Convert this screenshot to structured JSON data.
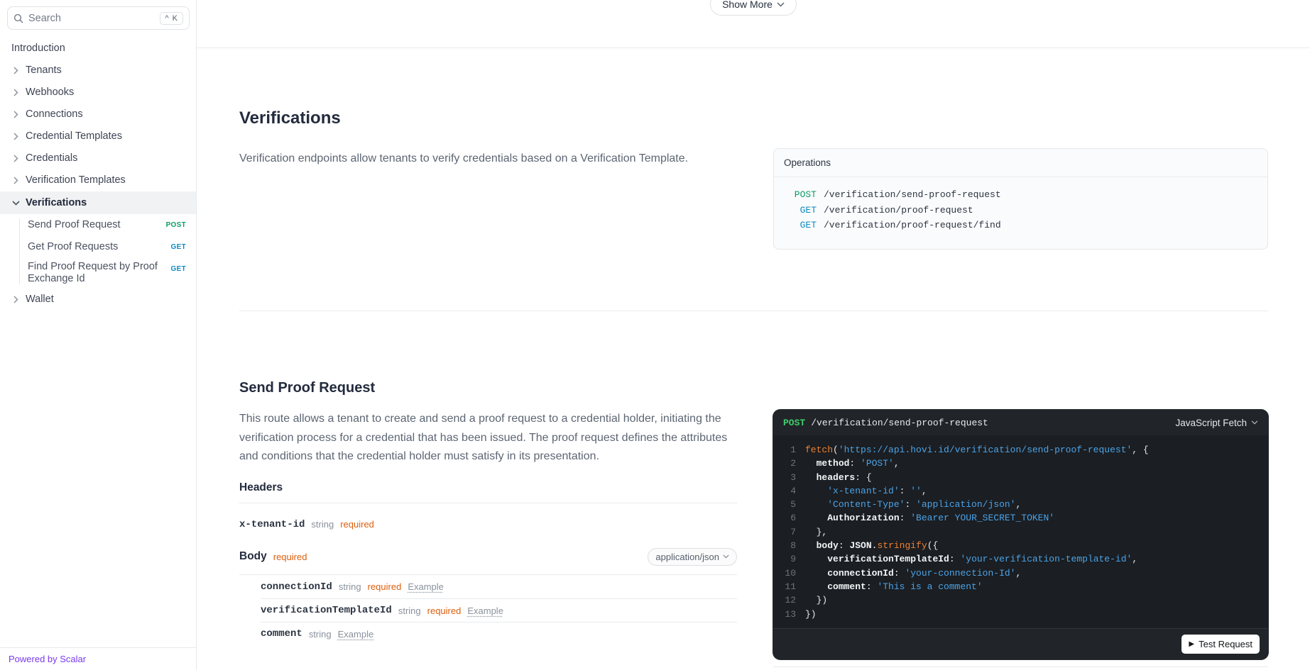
{
  "sidebar": {
    "search": {
      "placeholder": "Search",
      "shortcut": "^ K"
    },
    "items": [
      {
        "label": "Introduction",
        "chevron": "none"
      },
      {
        "label": "Tenants",
        "chevron": "right"
      },
      {
        "label": "Webhooks",
        "chevron": "right"
      },
      {
        "label": "Connections",
        "chevron": "right"
      },
      {
        "label": "Credential Templates",
        "chevron": "right"
      },
      {
        "label": "Credentials",
        "chevron": "right"
      },
      {
        "label": "Verification Templates",
        "chevron": "right"
      },
      {
        "label": "Verifications",
        "chevron": "down",
        "active": true,
        "children": [
          {
            "label": "Send Proof Request",
            "method": "POST"
          },
          {
            "label": "Get Proof Requests",
            "method": "GET"
          },
          {
            "label": "Find Proof Request by Proof Exchange Id",
            "method": "GET"
          }
        ]
      },
      {
        "label": "Wallet",
        "chevron": "right"
      }
    ],
    "footer_link": "Powered by Scalar"
  },
  "topbar": {
    "show_more_label": "Show More"
  },
  "page": {
    "title": "Verifications",
    "description": "Verification endpoints allow tenants to verify credentials based on a Verification Template.",
    "operations": {
      "title": "Operations",
      "items": [
        {
          "method": "POST",
          "path": "/verification/send-proof-request"
        },
        {
          "method": "GET",
          "path": "/verification/proof-request"
        },
        {
          "method": "GET",
          "path": "/verification/proof-request/find"
        }
      ]
    }
  },
  "endpoint": {
    "title": "Send Proof Request",
    "description": "This route allows a tenant to create and send a proof request to a credential holder, initiating the verification process for a credential that has been issued. The proof request defines the attributes and conditions that the credential holder must satisfy in its presentation.",
    "headers_section": {
      "title": "Headers",
      "params": [
        {
          "name": "x-tenant-id",
          "type": "string",
          "required": "required",
          "example": ""
        }
      ]
    },
    "body_section": {
      "title": "Body",
      "required": "required",
      "content_type": "application/json",
      "params": [
        {
          "name": "connectionId",
          "type": "string",
          "required": "required",
          "example": "Example"
        },
        {
          "name": "verificationTemplateId",
          "type": "string",
          "required": "required",
          "example": "Example"
        },
        {
          "name": "comment",
          "type": "string",
          "required": "",
          "example": "Example"
        }
      ]
    }
  },
  "code_panel": {
    "method": "POST",
    "path": "/verification/send-proof-request",
    "language": "JavaScript Fetch",
    "test_button": "Test Request",
    "lines": [
      [
        [
          "fn",
          "fetch"
        ],
        [
          "p",
          "("
        ],
        [
          "s",
          "'https://api.hovi.id/verification/send-proof-request'"
        ],
        [
          "p",
          ", {"
        ]
      ],
      [
        [
          "p",
          "  "
        ],
        [
          "k",
          "method"
        ],
        [
          "p",
          ": "
        ],
        [
          "s",
          "'POST'"
        ],
        [
          "p",
          ","
        ]
      ],
      [
        [
          "p",
          "  "
        ],
        [
          "k",
          "headers"
        ],
        [
          "p",
          ": {"
        ]
      ],
      [
        [
          "p",
          "    "
        ],
        [
          "s",
          "'x-tenant-id'"
        ],
        [
          "p",
          ": "
        ],
        [
          "s",
          "''"
        ],
        [
          "p",
          ","
        ]
      ],
      [
        [
          "p",
          "    "
        ],
        [
          "s",
          "'Content-Type'"
        ],
        [
          "p",
          ": "
        ],
        [
          "s",
          "'application/json'"
        ],
        [
          "p",
          ","
        ]
      ],
      [
        [
          "p",
          "    "
        ],
        [
          "k",
          "Authorization"
        ],
        [
          "p",
          ": "
        ],
        [
          "s",
          "'Bearer YOUR_SECRET_TOKEN'"
        ]
      ],
      [
        [
          "p",
          "  },"
        ]
      ],
      [
        [
          "p",
          "  "
        ],
        [
          "k",
          "body"
        ],
        [
          "p",
          ": "
        ],
        [
          "k",
          "JSON"
        ],
        [
          "p",
          "."
        ],
        [
          "fn",
          "stringify"
        ],
        [
          "p",
          "({"
        ]
      ],
      [
        [
          "p",
          "    "
        ],
        [
          "k",
          "verificationTemplateId"
        ],
        [
          "p",
          ": "
        ],
        [
          "s",
          "'your-verification-template-id'"
        ],
        [
          "p",
          ","
        ]
      ],
      [
        [
          "p",
          "    "
        ],
        [
          "k",
          "connectionId"
        ],
        [
          "p",
          ": "
        ],
        [
          "s",
          "'your-connection-Id'"
        ],
        [
          "p",
          ","
        ]
      ],
      [
        [
          "p",
          "    "
        ],
        [
          "k",
          "comment"
        ],
        [
          "p",
          ": "
        ],
        [
          "s",
          "'This is a comment'"
        ]
      ],
      [
        [
          "p",
          "  })"
        ]
      ],
      [
        [
          "p",
          "})"
        ]
      ]
    ]
  },
  "colors": {
    "post_green": "#0a9e63",
    "get_blue": "#0f8ac2",
    "required_orange": "#dd5e0c",
    "scalar_purple": "#7a3bec",
    "code_string_blue": "#4ba3e8",
    "code_fn_orange": "#ee8133",
    "code_header_green": "#3fcf6e"
  }
}
